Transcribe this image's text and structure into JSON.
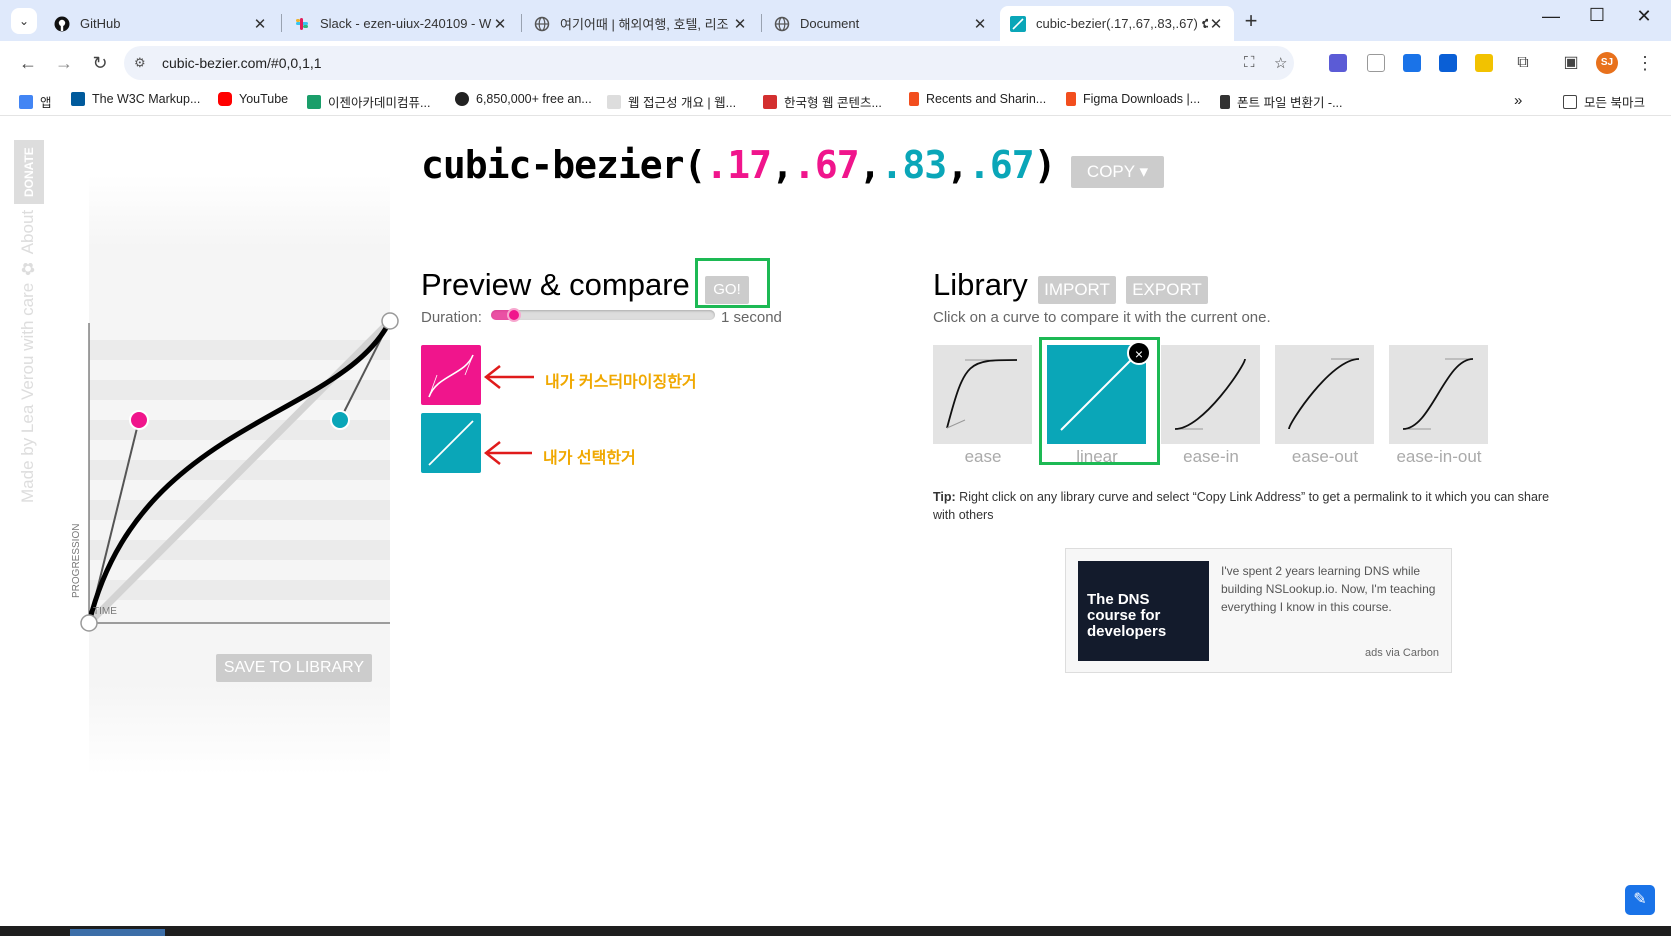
{
  "tabs": [
    {
      "title": "GitHub",
      "favicon": "github-icon",
      "color": "#111111"
    },
    {
      "title": "Slack - ezen-uiux-240109 - W",
      "favicon": "slack-icon",
      "color": "#e01e5a"
    },
    {
      "title": "여기어때 | 해외여행, 호텔, 리조",
      "favicon": "globe-icon",
      "color": "#666666"
    },
    {
      "title": "Document",
      "favicon": "globe-icon",
      "color": "#666666"
    },
    {
      "title": "cubic-bezier(.17,.67,.83,.67) ✿ c",
      "favicon": "bezier-icon",
      "color": "#0aa6b8"
    }
  ],
  "address": {
    "url": "cubic-bezier.com/#0,0,1,1"
  },
  "bookmarks": [
    {
      "label": "앱",
      "icon": "apps-icon",
      "color": "#4285f4"
    },
    {
      "label": "The W3C Markup...",
      "icon": "w3c-icon",
      "color": "#005a9c"
    },
    {
      "label": "YouTube",
      "icon": "youtube-icon",
      "color": "#ff0000"
    },
    {
      "label": "이젠아카데미컴퓨...",
      "icon": "ezen-icon",
      "color": "#1a9e6a"
    },
    {
      "label": "6,850,000+ free an...",
      "icon": "freepik-icon",
      "color": "#222222"
    },
    {
      "label": "웹 접근성 개요 | 웹...",
      "icon": "webaccess-icon",
      "color": "#444444"
    },
    {
      "label": "한국형 웹 콘텐츠...",
      "icon": "pdf-icon",
      "color": "#d32f2f"
    },
    {
      "label": "Recents and Sharin...",
      "icon": "figma-icon",
      "color": "#f24e1e"
    },
    {
      "label": "Figma Downloads |...",
      "icon": "figma-icon",
      "color": "#f24e1e"
    },
    {
      "label": "폰트 파일 변환기 -...",
      "icon": "wrench-icon",
      "color": "#333333"
    },
    {
      "label": "모든 북마크",
      "icon": "folder-icon",
      "color": "#444444"
    }
  ],
  "sidebar": {
    "donate": "DONATE",
    "about": "Made by Lea Verou with care ✿ About"
  },
  "title": {
    "prefix": "cubic-bezier(",
    "p1": ".17",
    "p2": ".67",
    "p3": ".83",
    "p4": ".67",
    "suffix": ")",
    "sep": ","
  },
  "copy_label": "COPY ▾",
  "graph": {
    "axis_y": "PROGRESSION",
    "axis_x": "TIME",
    "save_label": "SAVE TO LIBRARY"
  },
  "preview": {
    "heading": "Preview & compare",
    "go_label": "GO!",
    "duration_label": "Duration:",
    "duration_value": "1 second",
    "duration_seconds": 1
  },
  "annotations": {
    "custom": "내가 커스터마이징한거",
    "selected": "내가 선택한거"
  },
  "library": {
    "heading": "Library",
    "import_label": "IMPORT",
    "export_label": "EXPORT",
    "subtitle": "Click on a curve to compare it with the current one.",
    "items": [
      "ease",
      "linear",
      "ease-in",
      "ease-out",
      "ease-in-out"
    ],
    "selected": "linear",
    "close_symbol": "×"
  },
  "tip": {
    "label": "Tip:",
    "text": " Right click on any library curve and select “Copy Link Address” to get a permalink to it which you can share with others"
  },
  "ad": {
    "image_text": "The DNS course for developers",
    "text": "I've spent 2 years learning DNS while building NSLookup.io. Now, I'm teaching everything I know in this course.",
    "via": "ads via Carbon"
  },
  "colors": {
    "pink": "#f0158c",
    "teal": "#0aa6b8",
    "highlight": "#1db954",
    "annotation": "#f0a800"
  }
}
